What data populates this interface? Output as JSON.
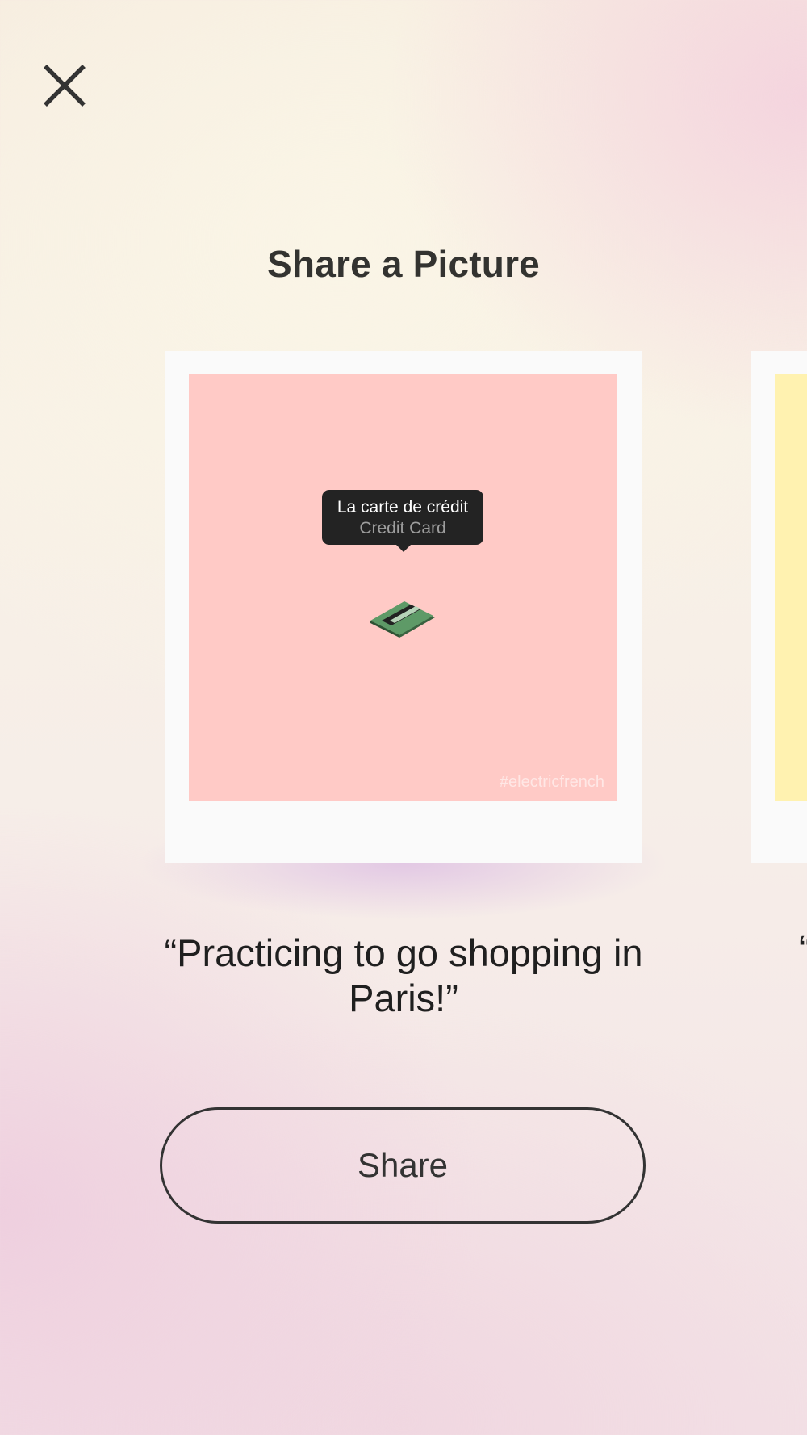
{
  "header": {
    "close_icon": "close-icon",
    "title": "Share a Picture"
  },
  "card": {
    "tooltip_french": "La carte de crédit",
    "tooltip_english": "Credit Card",
    "object_icon": "credit-card-icon",
    "watermark": "#electricfrench",
    "photo_color": "#ffcac6",
    "caption": "“Practicing to go shopping in Paris!”"
  },
  "next_card": {
    "photo_color": "#fff2b0",
    "caption_start": "“"
  },
  "actions": {
    "share_label": "Share"
  }
}
